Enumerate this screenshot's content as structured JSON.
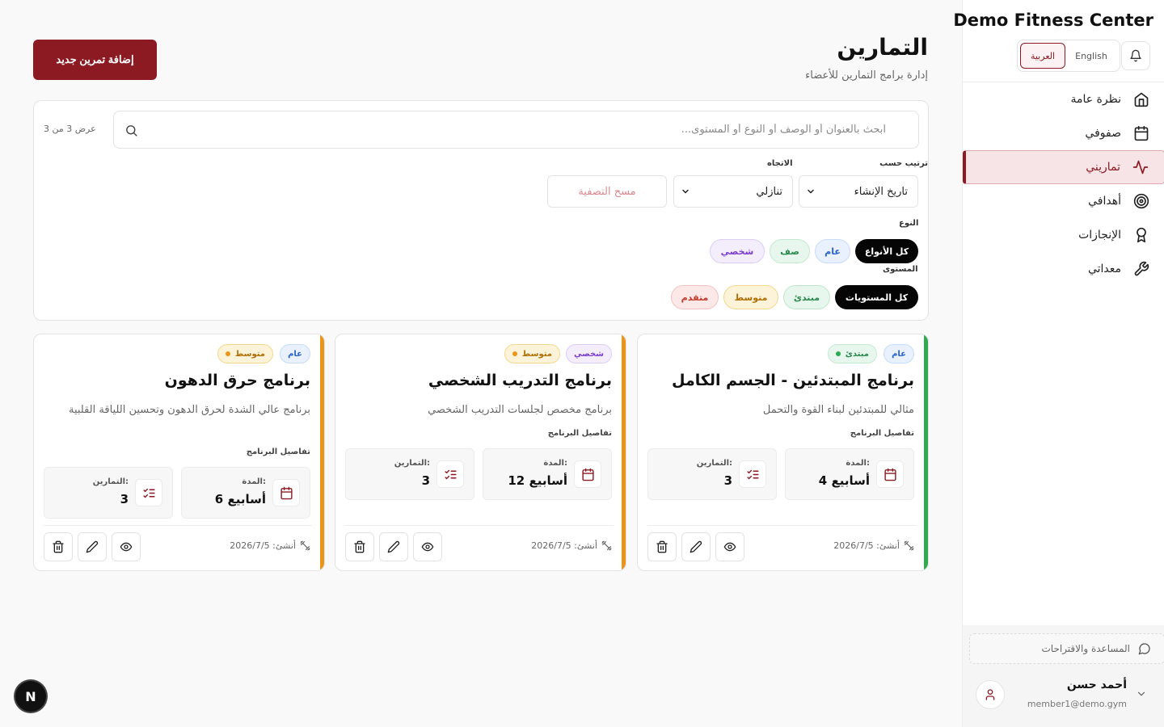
{
  "brand": "Demo Fitness Center",
  "lang": {
    "arabic": "العربية",
    "english": "English"
  },
  "nav": [
    {
      "label": "نظرة عامة",
      "icon": "home-icon"
    },
    {
      "label": "صفوفي",
      "icon": "calendar-icon"
    },
    {
      "label": "تماريني",
      "icon": "activity-icon",
      "active": true
    },
    {
      "label": "أهدافي",
      "icon": "target-icon"
    },
    {
      "label": "الإنجازات",
      "icon": "award-icon"
    },
    {
      "label": "معداتي",
      "icon": "wrench-icon"
    }
  ],
  "help": "المساعدة والاقتراحات",
  "user": {
    "name": "أحمد حسن",
    "email": "member1@demo.gym"
  },
  "header": {
    "title": "التمارين",
    "subtitle": "إدارة برامج التمارين للأعضاء",
    "add_button": "إضافة تمرين جديد"
  },
  "filters": {
    "search_placeholder": "ابحث بالعنوان أو الوصف أو النوع أو المستوى...",
    "count": "عرض 3 من 3",
    "sort_label": "ترتيب حسب",
    "sort_value": "تاريخ الإنشاء",
    "direction_label": "الاتجاه",
    "direction_value": "تنازلي",
    "clear": "مسح التصفية",
    "type_label": "النوع",
    "types": [
      "كل الأنواع",
      "عام",
      "صف",
      "شخصي"
    ],
    "level_label": "المستوى",
    "levels": [
      "كل المستويات",
      "مبتدئ",
      "متوسط",
      "متقدم"
    ]
  },
  "cards": [
    {
      "type": "عام",
      "level": "مبتدئ",
      "title": "برنامج المبتدئين - الجسم الكامل",
      "description": "مثالي للمبتدئين لبناء القوة والتحمل",
      "details_label": "تفاصيل البرنامج",
      "duration_label": "المدة:",
      "duration": "4 أسابيع",
      "exercises_label": "التمارين:",
      "exercises": "3",
      "created": "أنشئ: 2026/7/5",
      "accent": "#2eaa4f"
    },
    {
      "type": "شخصي",
      "level": "متوسط",
      "title": "برنامج التدريب الشخصي",
      "description": "برنامج مخصص لجلسات التدريب الشخصي",
      "details_label": "تفاصيل البرنامج",
      "duration_label": "المدة:",
      "duration": "12 أسابيع",
      "exercises_label": "التمارين:",
      "exercises": "3",
      "created": "أنشئ: 2026/7/5",
      "accent": "#e8951a"
    },
    {
      "type": "عام",
      "level": "متوسط",
      "title": "برنامج حرق الدهون",
      "description": "برنامج عالي الشدة لحرق الدهون وتحسين اللياقة القلبية",
      "details_label": "تفاصيل البرنامج",
      "duration_label": "المدة:",
      "duration": "6 أسابيع",
      "exercises_label": "التمارين:",
      "exercises": "3",
      "created": "أنشئ: 2026/7/5",
      "accent": "#e8951a"
    }
  ],
  "dev_badge": "N",
  "colors": {
    "primary": "#8b1a22",
    "beginner": "#2eaa4f",
    "intermediate": "#e8951a",
    "advanced": "#c0392b"
  }
}
